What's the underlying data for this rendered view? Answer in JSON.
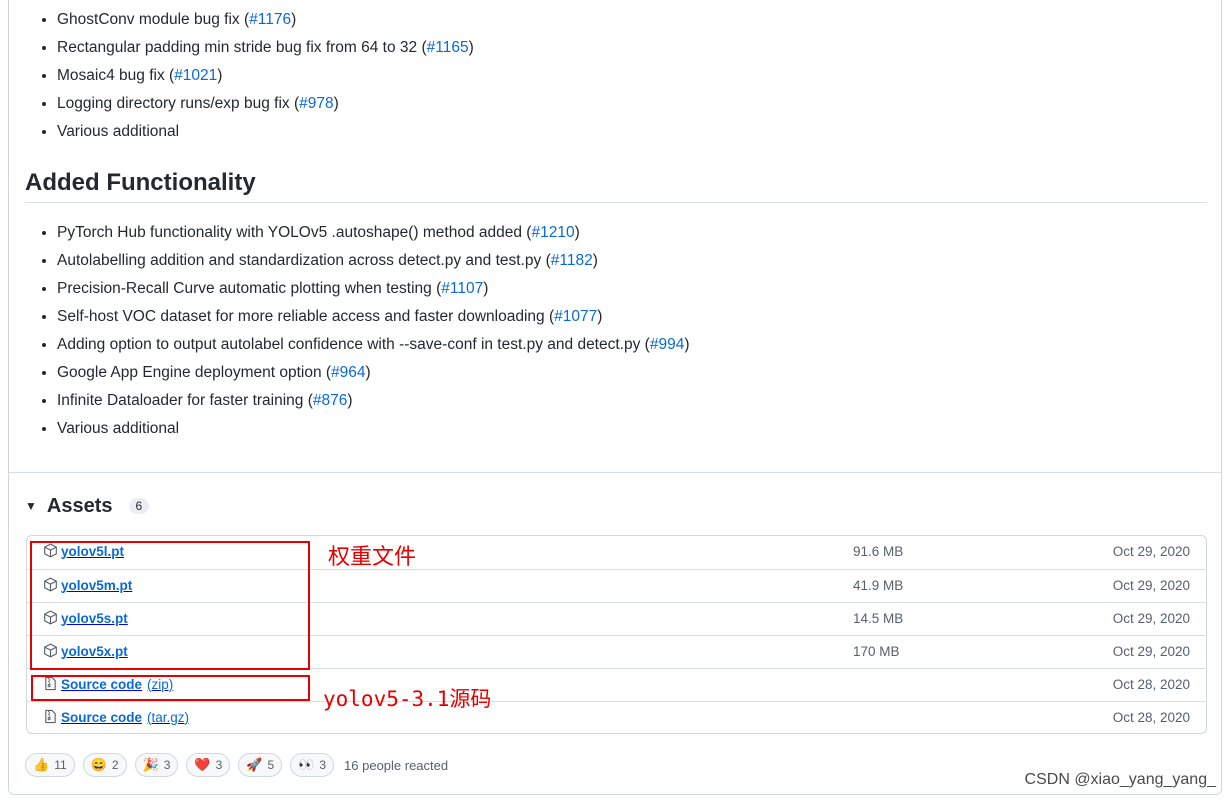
{
  "fixes_list": [
    {
      "text": "GhostConv module bug fix ",
      "ref": "#1176"
    },
    {
      "text": "Rectangular padding min stride bug fix from 64 to 32 ",
      "ref": "#1165"
    },
    {
      "text": "Mosaic4 bug fix ",
      "ref": "#1021"
    },
    {
      "text": "Logging directory runs/exp bug fix ",
      "ref": "#978"
    },
    {
      "text": "Various additional",
      "ref": ""
    }
  ],
  "added_section": {
    "title": "Added Functionality",
    "items": [
      {
        "text": "PyTorch Hub functionality with YOLOv5 .autoshape() method added ",
        "ref": "#1210"
      },
      {
        "text": "Autolabelling addition and standardization across detect.py and test.py ",
        "ref": "#1182"
      },
      {
        "text": "Precision-Recall Curve automatic plotting when testing ",
        "ref": "#1107"
      },
      {
        "text": "Self-host VOC dataset for more reliable access and faster downloading ",
        "ref": "#1077"
      },
      {
        "text": "Adding option to output autolabel confidence with --save-conf in test.py and detect.py ",
        "ref": "#994"
      },
      {
        "text": "Google App Engine deployment option ",
        "ref": "#964"
      },
      {
        "text": "Infinite Dataloader for faster training ",
        "ref": "#876"
      },
      {
        "text": "Various additional",
        "ref": ""
      }
    ]
  },
  "assets": {
    "title": "Assets",
    "count": "6",
    "rows": [
      {
        "icon": "package-icon",
        "name": "yolov5l.pt",
        "format": "",
        "size": "91.6 MB",
        "date": "Oct 29, 2020"
      },
      {
        "icon": "package-icon",
        "name": "yolov5m.pt",
        "format": "",
        "size": "41.9 MB",
        "date": "Oct 29, 2020"
      },
      {
        "icon": "package-icon",
        "name": "yolov5s.pt",
        "format": "",
        "size": "14.5 MB",
        "date": "Oct 29, 2020"
      },
      {
        "icon": "package-icon",
        "name": "yolov5x.pt",
        "format": "",
        "size": "170 MB",
        "date": "Oct 29, 2020"
      },
      {
        "icon": "file-zip-icon",
        "name": "Source code",
        "format": "(zip)",
        "size": "",
        "date": "Oct 28, 2020"
      },
      {
        "icon": "file-zip-icon",
        "name": "Source code",
        "format": "(tar.gz)",
        "size": "",
        "date": "Oct 28, 2020"
      }
    ]
  },
  "annotations": {
    "weights_label": "权重文件",
    "source_label": "yolov5-3.1源码",
    "color": "#e60000"
  },
  "reactions": {
    "items": [
      {
        "icon": "thumbs-up-icon",
        "emoji": "👍",
        "count": "11"
      },
      {
        "icon": "laugh-icon",
        "emoji": "😄",
        "count": "2"
      },
      {
        "icon": "hooray-icon",
        "emoji": "🎉",
        "count": "3"
      },
      {
        "icon": "heart-icon",
        "emoji": "❤️",
        "count": "3"
      },
      {
        "icon": "rocket-icon",
        "emoji": "🚀",
        "count": "5"
      },
      {
        "icon": "eyes-icon",
        "emoji": "👀",
        "count": "3"
      }
    ],
    "summary": "16 people reacted"
  },
  "watermark": "CSDN @xiao_yang_yang_",
  "colors": {
    "link": "#0969da",
    "text": "#24292f",
    "muted": "#57606a",
    "border": "#d0d7de"
  }
}
